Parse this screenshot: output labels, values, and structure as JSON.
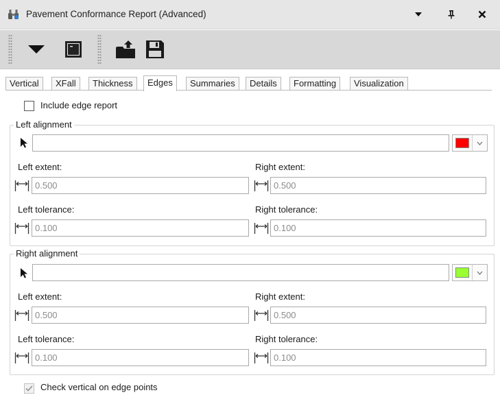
{
  "window": {
    "title": "Pavement Conformance Report (Advanced)",
    "icons": {
      "app": "binoculars-icon",
      "menu": "chevron-down-icon",
      "pin": "pin-icon",
      "close": "close-icon"
    }
  },
  "toolbar": {
    "icons": [
      "dropdown-arrow-icon",
      "terminal-icon",
      "open-folder-icon",
      "save-icon"
    ]
  },
  "tabs": [
    {
      "label": "Vertical",
      "active": false
    },
    {
      "label": "XFall",
      "active": false
    },
    {
      "label": "Thickness",
      "active": false
    },
    {
      "label": "Edges",
      "active": true
    },
    {
      "label": "Summaries",
      "active": false
    },
    {
      "label": "Details",
      "active": false
    },
    {
      "label": "Formatting",
      "active": false
    },
    {
      "label": "Visualization",
      "active": false
    }
  ],
  "edges": {
    "include_label": "Include edge report",
    "include_checked": false,
    "left": {
      "title": "Left alignment",
      "color": "#ff0000",
      "alignment_value": "",
      "left_extent_label": "Left extent:",
      "left_extent": "0.500",
      "right_extent_label": "Right extent:",
      "right_extent": "0.500",
      "left_tol_label": "Left tolerance:",
      "left_tol": "0.100",
      "right_tol_label": "Right tolerance:",
      "right_tol": "0.100"
    },
    "right": {
      "title": "Right alignment",
      "color": "#99ff33",
      "alignment_value": "",
      "left_extent_label": "Left extent:",
      "left_extent": "0.500",
      "right_extent_label": "Right extent:",
      "right_extent": "0.500",
      "left_tol_label": "Left tolerance:",
      "left_tol": "0.100",
      "right_tol_label": "Right tolerance:",
      "right_tol": "0.100"
    },
    "check_vertical_label": "Check vertical on edge points",
    "check_vertical_checked": true
  }
}
